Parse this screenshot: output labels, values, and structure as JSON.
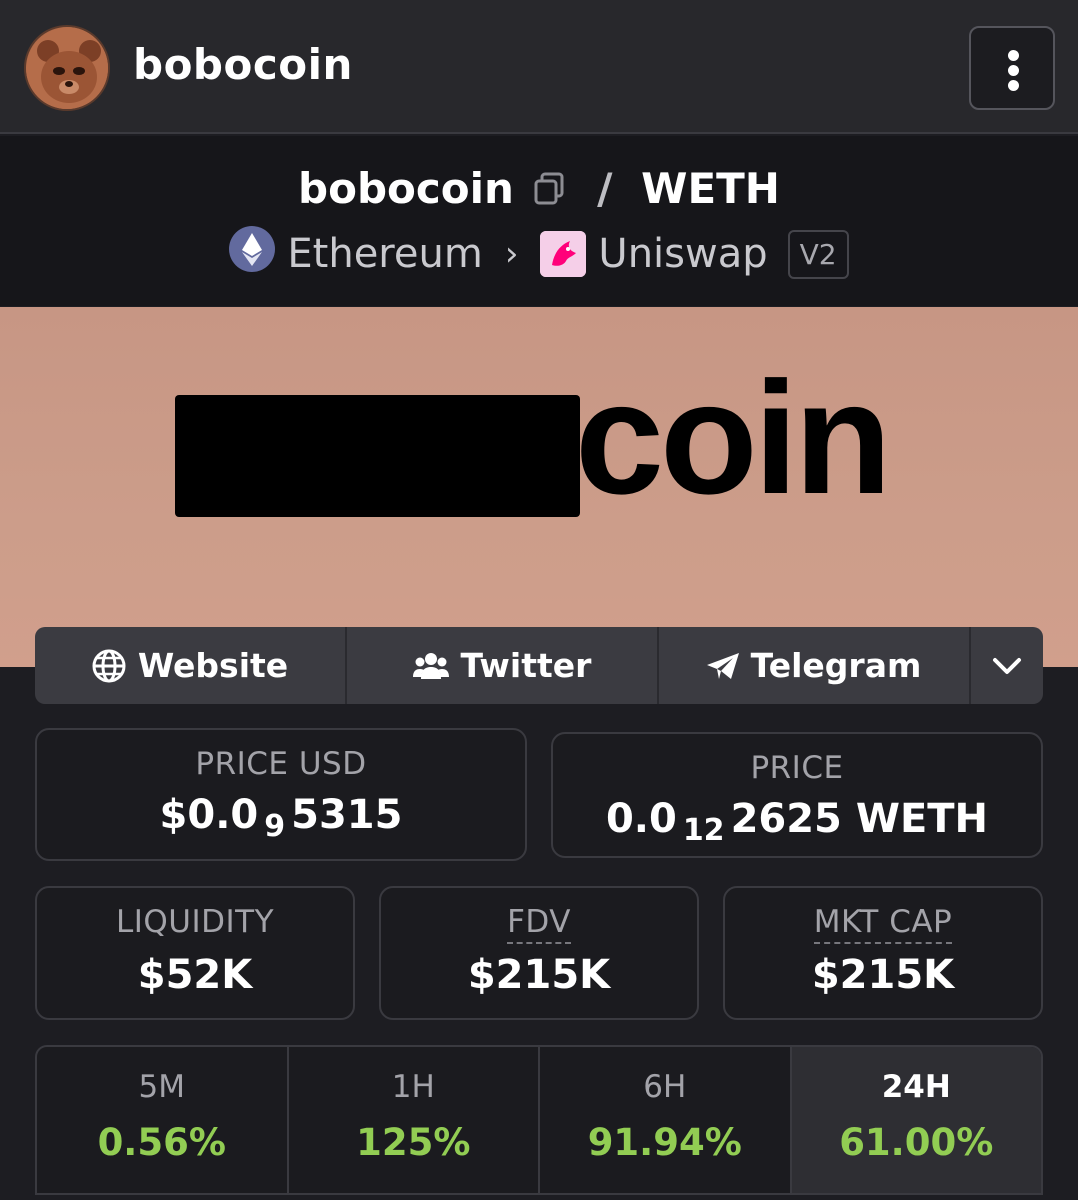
{
  "topbar": {
    "token_name": "bobocoin"
  },
  "pair": {
    "base": "bobocoin",
    "separator": "/",
    "quote": "WETH",
    "chain": "Ethereum",
    "dex": "Uniswap",
    "version": "V2"
  },
  "banner": {
    "visible_text": "coin"
  },
  "links": {
    "website": "Website",
    "twitter": "Twitter",
    "telegram": "Telegram"
  },
  "stats": {
    "price_usd": {
      "label": "PRICE USD",
      "prefix": "$0.0",
      "zeros": "9",
      "digits": "5315"
    },
    "price": {
      "label": "PRICE",
      "prefix": "0.0",
      "zeros": "12",
      "digits": "2625 WETH"
    },
    "liquidity": {
      "label": "LIQUIDITY",
      "value": "$52K"
    },
    "fdv": {
      "label": "FDV",
      "value": "$215K"
    },
    "mkt_cap": {
      "label": "MKT CAP",
      "value": "$215K"
    }
  },
  "changes": [
    {
      "period": "5M",
      "value": "0.56%"
    },
    {
      "period": "1H",
      "value": "125%"
    },
    {
      "period": "6H",
      "value": "91.94%"
    },
    {
      "period": "24H",
      "value": "61.00%"
    }
  ],
  "colors": {
    "positive": "#92cd53",
    "banner": "#c99a87",
    "background": "#1d1d22"
  }
}
